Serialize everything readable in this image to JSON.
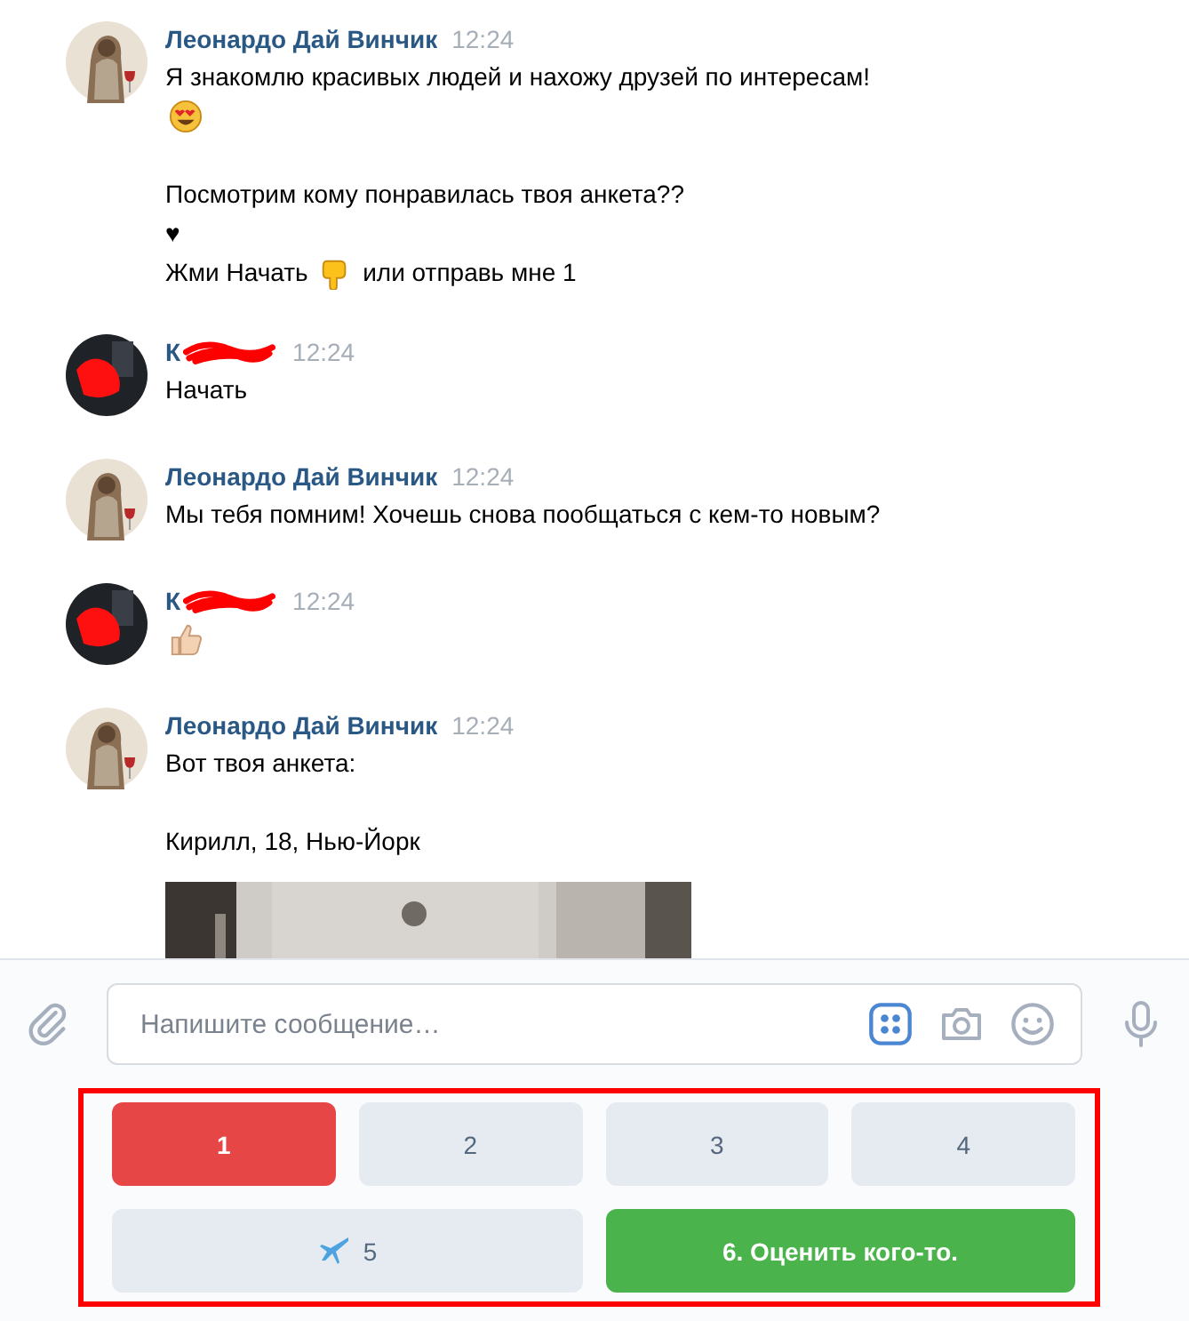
{
  "messages": [
    {
      "avatar": {
        "kind": "sage"
      },
      "author": "Леонардо Дай Винчик",
      "redacted": false,
      "time": "12:24",
      "paragraphs": [
        [
          [
            {
              "kind": "text",
              "text": "Я знакомлю красивых людей и нахожу друзей по интересам!"
            }
          ],
          [
            {
              "kind": "smiley"
            }
          ]
        ],
        [
          [
            {
              "kind": "text",
              "text": "Посмотрим кому понравилась твоя анкета??"
            }
          ],
          [
            {
              "kind": "text",
              "text": "♥"
            }
          ],
          [
            {
              "kind": "text",
              "text": "Жми Начать "
            },
            {
              "kind": "pointer"
            },
            {
              "kind": "text",
              "text": " или отправь мне 1"
            }
          ]
        ]
      ]
    },
    {
      "avatar": {
        "kind": "user"
      },
      "author": "К",
      "redacted": true,
      "time": "12:24",
      "paragraphs": [
        [
          [
            {
              "kind": "text",
              "text": "Начать"
            }
          ]
        ]
      ]
    },
    {
      "avatar": {
        "kind": "sage"
      },
      "author": "Леонардо Дай Винчик",
      "redacted": false,
      "time": "12:24",
      "paragraphs": [
        [
          [
            {
              "kind": "text",
              "text": "Мы тебя помним! Хочешь снова пообщаться с кем-то новым?"
            }
          ]
        ]
      ]
    },
    {
      "avatar": {
        "kind": "user"
      },
      "author": "К",
      "redacted": true,
      "time": "12:24",
      "paragraphs": [
        [
          [
            {
              "kind": "thumb"
            }
          ]
        ]
      ]
    },
    {
      "avatar": {
        "kind": "sage"
      },
      "author": "Леонардо Дай Винчик",
      "redacted": false,
      "time": "12:24",
      "paragraphs": [
        [
          [
            {
              "kind": "text",
              "text": "Вот твоя анкета:"
            }
          ]
        ],
        [
          [
            {
              "kind": "text",
              "text": "Кирилл, 18, Нью-Йорк"
            }
          ]
        ]
      ],
      "attachment": {
        "kind": "picture"
      }
    }
  ],
  "composer": {
    "placeholder": "Напишите сообщение…",
    "keyboard_active": true
  },
  "keyboard": {
    "highlighted": true,
    "rows": [
      [
        {
          "label": "1",
          "kind": "negative",
          "has_icon": false
        },
        {
          "label": "2",
          "kind": "secondary",
          "has_icon": false
        },
        {
          "label": "3",
          "kind": "secondary",
          "has_icon": false
        },
        {
          "label": "4",
          "kind": "secondary",
          "has_icon": false
        }
      ],
      [
        {
          "label": "5",
          "kind": "secondary",
          "has_icon": true
        },
        {
          "label": "6. Оценить кого-то.",
          "kind": "positive",
          "has_icon": false
        }
      ]
    ]
  }
}
